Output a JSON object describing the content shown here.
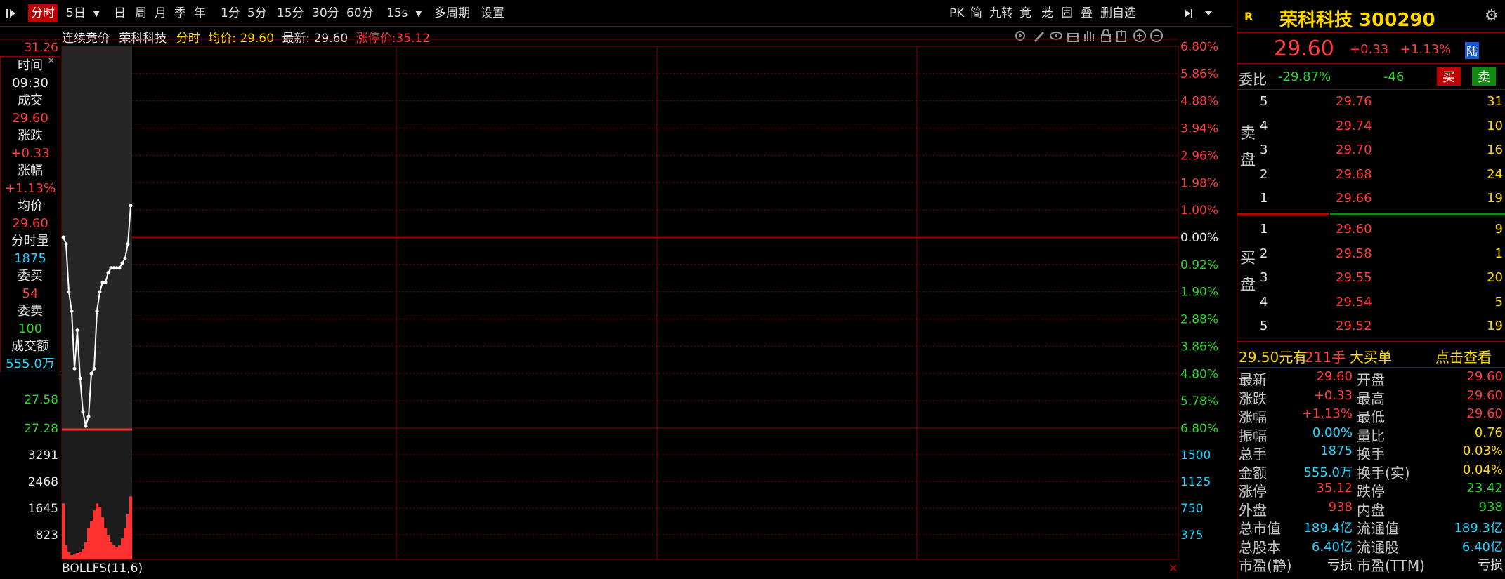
{
  "toolbar": {
    "items": [
      "分时",
      "5日",
      "日",
      "周",
      "月",
      "季",
      "年",
      "1分",
      "5分",
      "15分",
      "30分",
      "60分",
      "15s",
      "多周期",
      "设置"
    ],
    "right_items": [
      "PK",
      "简",
      "九转",
      "竞",
      "茏",
      "固",
      "叠",
      "删自选"
    ]
  },
  "info_bar": {
    "phase": "连续竞价",
    "stock_name": "荣科科技",
    "mode": "分时",
    "avg_label": "均价: 29.60",
    "latest_label": "最新: 29.60",
    "limit_label": "涨停价:35.12"
  },
  "hover_box": {
    "rows": [
      {
        "label": "时间",
        "value": "09:30",
        "color": "#e6e6e6"
      },
      {
        "label": "成交",
        "value": "29.60",
        "color": "#ff3b3b"
      },
      {
        "label": "涨跌",
        "value": "+0.33",
        "color": "#ff3b3b"
      },
      {
        "label": "涨幅",
        "value": "+1.13%",
        "color": "#ff3b3b"
      },
      {
        "label": "均价",
        "value": "29.60",
        "color": "#ff3b3b"
      },
      {
        "label": "分时量",
        "value": "1875",
        "color": "#21d4ff"
      },
      {
        "label": "委买",
        "value": "54",
        "color": "#ff3b3b"
      },
      {
        "label": "委卖",
        "value": "100",
        "color": "#2bd62b"
      },
      {
        "label": "成交额",
        "value": "555.0万",
        "color": "#21d4ff"
      }
    ]
  },
  "price_axis": {
    "left_top": "31.26",
    "left_labels": [
      "27.58",
      "27.28"
    ],
    "right_pct": [
      "6.80%",
      "5.86%",
      "4.88%",
      "3.94%",
      "2.96%",
      "1.98%",
      "1.00%",
      "0.00%",
      "0.92%",
      "1.90%",
      "2.88%",
      "3.86%",
      "4.80%",
      "5.78%",
      "6.80%"
    ]
  },
  "volume_axis": {
    "left": [
      "3291",
      "2468",
      "1645",
      "823"
    ],
    "right": [
      "1500",
      "1125",
      "750",
      "375"
    ]
  },
  "indicator_label": "BOLLFS(11,6)",
  "quote": {
    "badge": "R",
    "title": "荣科科技 300290",
    "price": "29.60",
    "change": "+0.33",
    "change_pct": "+1.13%",
    "tag": "陆",
    "weibi_label": "委比",
    "weibi_pct": "-29.87%",
    "weibi_diff": "-46",
    "buy_btn": "买",
    "sell_btn": "卖",
    "sell_side_label": [
      "卖",
      "盘"
    ],
    "buy_side_label": [
      "买",
      "盘"
    ],
    "asks": [
      {
        "lvl": "5",
        "price": "29.76",
        "vol": "31"
      },
      {
        "lvl": "4",
        "price": "29.74",
        "vol": "10"
      },
      {
        "lvl": "3",
        "price": "29.70",
        "vol": "16"
      },
      {
        "lvl": "2",
        "price": "29.68",
        "vol": "24"
      },
      {
        "lvl": "1",
        "price": "29.66",
        "vol": "19"
      }
    ],
    "bids": [
      {
        "lvl": "1",
        "price": "29.60",
        "vol": "9"
      },
      {
        "lvl": "2",
        "price": "29.58",
        "vol": "1"
      },
      {
        "lvl": "3",
        "price": "29.55",
        "vol": "20"
      },
      {
        "lvl": "4",
        "price": "29.54",
        "vol": "5"
      },
      {
        "lvl": "5",
        "price": "29.52",
        "vol": "19"
      }
    ],
    "big_order": {
      "price": "29.50元有",
      "qty": "211手",
      "kind": "大买单",
      "link": "点击查看"
    },
    "stats": [
      {
        "l1": "最新",
        "v1": "29.60",
        "c1": "#ff3b3b",
        "l2": "开盘",
        "v2": "29.60",
        "c2": "#ff3b3b"
      },
      {
        "l1": "涨跌",
        "v1": "+0.33",
        "c1": "#ff3b3b",
        "l2": "最高",
        "v2": "29.60",
        "c2": "#ff3b3b"
      },
      {
        "l1": "涨幅",
        "v1": "+1.13%",
        "c1": "#ff3b3b",
        "l2": "最低",
        "v2": "29.60",
        "c2": "#ff3b3b"
      },
      {
        "l1": "振幅",
        "v1": "0.00%",
        "c1": "#21d4ff",
        "l2": "量比",
        "v2": "0.76",
        "c2": "#ffd800"
      },
      {
        "l1": "总手",
        "v1": "1875",
        "c1": "#21d4ff",
        "l2": "换手",
        "v2": "0.03%",
        "c2": "#ffd800"
      },
      {
        "l1": "金额",
        "v1": "555.0万",
        "c1": "#21d4ff",
        "l2": "换手(实)",
        "v2": "0.04%",
        "c2": "#ffd800"
      },
      {
        "l1": "涨停",
        "v1": "35.12",
        "c1": "#ff3b3b",
        "l2": "跌停",
        "v2": "23.42",
        "c2": "#2bd62b"
      },
      {
        "l1": "外盘",
        "v1": "938",
        "c1": "#ff3b3b",
        "l2": "内盘",
        "v2": "938",
        "c2": "#2bd62b"
      },
      {
        "l1": "总市值",
        "v1": "189.4亿",
        "c1": "#21d4ff",
        "l2": "流通值",
        "v2": "189.3亿",
        "c2": "#21d4ff"
      },
      {
        "l1": "总股本",
        "v1": "6.40亿",
        "c1": "#21d4ff",
        "l2": "流通股",
        "v2": "6.40亿",
        "c2": "#21d4ff"
      },
      {
        "l1": "市盈(静)",
        "v1": "亏损",
        "c1": "#e6e6e6",
        "l2": "市盈(TTM)",
        "v2": "亏损",
        "c2": "#e6e6e6"
      }
    ]
  },
  "chart_data": {
    "type": "line",
    "x": [
      "09:30",
      "09:30",
      "09:30",
      "09:31",
      "09:31",
      "09:31",
      "09:31",
      "09:32",
      "09:32",
      "09:32",
      "09:33",
      "09:33",
      "09:34",
      "09:34",
      "09:34",
      "09:35",
      "09:36",
      "09:37",
      "09:38",
      "09:39",
      "09:40",
      "09:40",
      "09:41",
      "09:41",
      "09:41"
    ],
    "series": [
      {
        "values": [
          29.27,
          29.2,
          28.7,
          28.5,
          27.9,
          28.3,
          27.8,
          27.45,
          27.3,
          27.4,
          27.85,
          27.9,
          28.5,
          28.7,
          28.8,
          28.8,
          28.9,
          28.95,
          28.95,
          28.95,
          28.95,
          29.0,
          29.05,
          29.2,
          29.6
        ]
      }
    ],
    "volume": [
      1600,
      400,
      200,
      120,
      150,
      180,
      220,
      300,
      500,
      900,
      1100,
      1400,
      1600,
      1500,
      1200,
      900,
      700,
      500,
      400,
      350,
      400,
      600,
      900,
      1300,
      1800
    ],
    "ylim": [
      27.28,
      31.26
    ],
    "prev_close": 29.27
  }
}
